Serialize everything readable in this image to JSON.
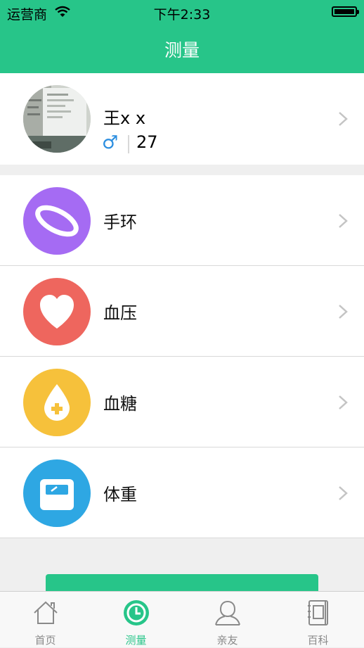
{
  "status_bar": {
    "carrier": "运营商",
    "time": "下午2:33"
  },
  "navbar": {
    "title": "测量"
  },
  "profile": {
    "name": "王x x",
    "gender_symbol": "♂",
    "age": "27"
  },
  "menu": [
    {
      "label": "手环",
      "icon": "band-icon",
      "color": "#a56bf3"
    },
    {
      "label": "血压",
      "icon": "heart-icon",
      "color": "#ee665e"
    },
    {
      "label": "血糖",
      "icon": "drop-icon",
      "color": "#f6c13b"
    },
    {
      "label": "体重",
      "icon": "scale-icon",
      "color": "#2ea7e3"
    }
  ],
  "tabs": [
    {
      "label": "首页",
      "icon": "home-icon"
    },
    {
      "label": "测量",
      "icon": "clock-icon",
      "active": true
    },
    {
      "label": "亲友",
      "icon": "person-icon"
    },
    {
      "label": "百科",
      "icon": "book-icon"
    }
  ],
  "colors": {
    "accent": "#27c589",
    "background": "#efefef"
  }
}
